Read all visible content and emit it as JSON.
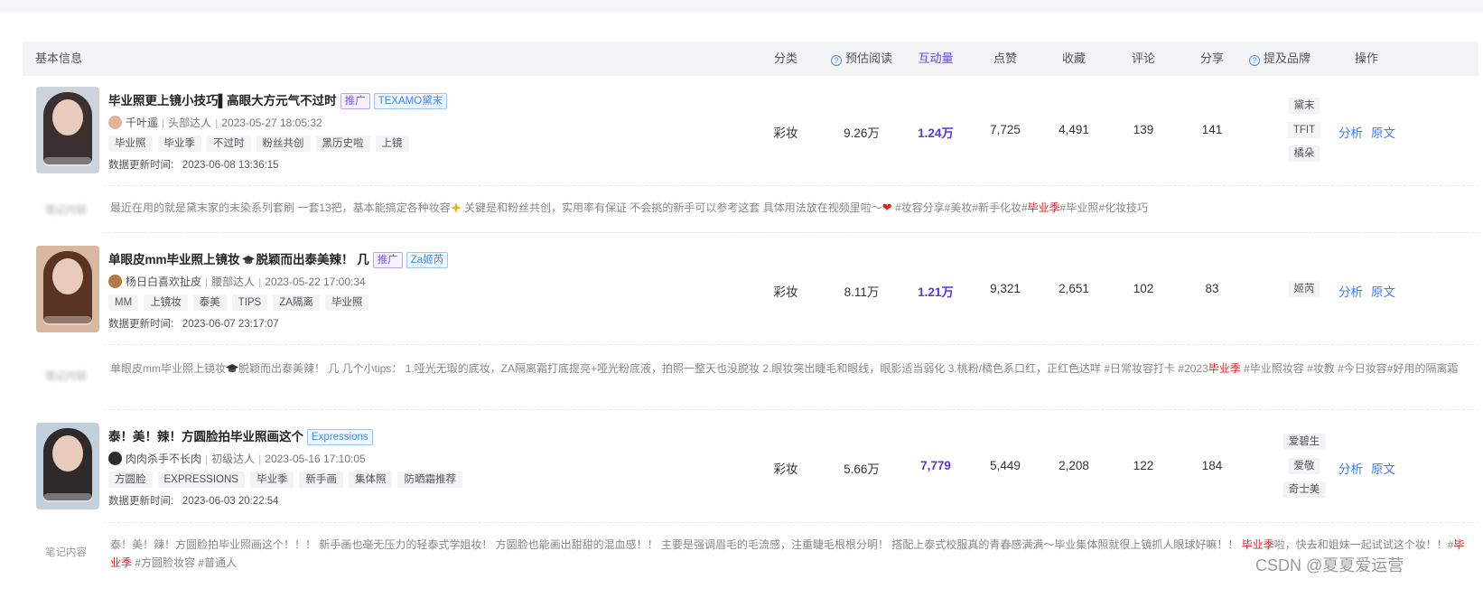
{
  "header": {
    "basic_info": "基本信息",
    "category": "分类",
    "est_read": "预估阅读",
    "interaction": "互动量",
    "likes": "点赞",
    "favorites": "收藏",
    "comments": "评论",
    "shares": "分享",
    "brand_mention": "提及品牌",
    "actions": "操作"
  },
  "rows": [
    {
      "title": "毕业照更上镜小技巧▌高眼大方元气不过时",
      "badges": [
        "推广",
        "TEXAMO黛末"
      ],
      "author": "千叶遥",
      "level": "头部达人",
      "date": "2023-05-27 18:05:32",
      "tags": [
        "毕业照",
        "毕业季",
        "不过时",
        "粉丝共创",
        "黑历史啦",
        "上镜"
      ],
      "update_label": "数据更新时间:",
      "update_time": "2023-06-08 13:36:15",
      "category": "彩妆",
      "est_read": "9.26万",
      "interaction": "1.24万",
      "likes": "7,725",
      "favorites": "4,491",
      "comments": "139",
      "shares": "141",
      "brands": [
        "黛末",
        "TFIT",
        "橘朵"
      ],
      "action_analyze": "分析",
      "action_original": "原文",
      "note_label": "笔记内容",
      "note_text_1": "最近在用的就是黛末家的未染系列套刷 一套13把，基本能搞定各种妆容",
      "note_text_2": " 关键是和粉丝共创，实用率有保证 不会挑的新手可以参考这套 具体用法放在视频里啦～",
      "note_text_3": " #妆容分享#美妆#新手化妆#",
      "note_red": "毕业季",
      "note_text_4": "#毕业照#化妆技巧"
    },
    {
      "title": "单眼皮mm毕业照上镜妆",
      "title_2": "脱颖而出泰美辣！ 几",
      "badges": [
        "推广",
        "Za姬芮"
      ],
      "author": "杨日白喜欢扯皮",
      "level": "腰部达人",
      "date": "2023-05-22 17:00:34",
      "tags": [
        "MM",
        "上镜妆",
        "泰美",
        "TIPS",
        "ZA隔离",
        "毕业照"
      ],
      "update_label": "数据更新时间:",
      "update_time": "2023-06-07 23:17:07",
      "category": "彩妆",
      "est_read": "8.11万",
      "interaction": "1.21万",
      "likes": "9,321",
      "favorites": "2,651",
      "comments": "102",
      "shares": "83",
      "brands": [
        "姬芮"
      ],
      "action_analyze": "分析",
      "action_original": "原文",
      "note_label": "笔记内容",
      "note_text_1": "单眼皮mm毕业照上镜妆",
      "note_text_2": "脱颖而出泰美辣！ 几 几个小tips： 1.哑光无瑕的底妆，ZA隔离霜打底提亮+哑光粉底液，拍照一整天也没脱妆 2.眼妆突出睫毛和眼线，眼影适当弱化 3.桃粉/橘色系口红，正红色达咩 #日常妆容打卡 #2023",
      "note_red": "毕业季",
      "note_text_3": " #毕业照妆容 #妆教 #今日妆容#好用的隔离霜"
    },
    {
      "title": "泰！美！辣！方圆脸拍毕业照画这个",
      "badges": [
        "Expressions"
      ],
      "author": "肉肉杀手不长肉",
      "level": "初级达人",
      "date": "2023-05-16 17:10:05",
      "tags": [
        "方圆脸",
        "EXPRESSIONS",
        "毕业季",
        "新手画",
        "集体照",
        "防晒霜推荐"
      ],
      "update_label": "数据更新时间:",
      "update_time": "2023-06-03 20:22:54",
      "category": "彩妆",
      "est_read": "5.66万",
      "interaction": "7,779",
      "likes": "5,449",
      "favorites": "2,208",
      "comments": "122",
      "shares": "184",
      "brands": [
        "爱碧生",
        "爱敬",
        "奇士美"
      ],
      "action_analyze": "分析",
      "action_original": "原文",
      "note_label": "笔记内容",
      "note_text_1": "泰！美！辣！方圆脸拍毕业照画这个！！！ 新手画也毫无压力的轻泰式学姐妆！ 方圆脸也能画出甜甜的混血感！！ 主要是强调眉毛的毛流感，注重睫毛根根分明！ 搭配上泰式校服真的青春感满满～毕业集体照就很上镜抓人眼球好嘛！！ ",
      "note_red": "毕业季",
      "note_text_2": "啦，快去和姐妹一起试试这个妆！！#",
      "note_red_2": "毕业季",
      "note_text_3": " #方圆脸妆容 #普通人"
    }
  ],
  "watermark": "CSDN @夏夏爱运营"
}
